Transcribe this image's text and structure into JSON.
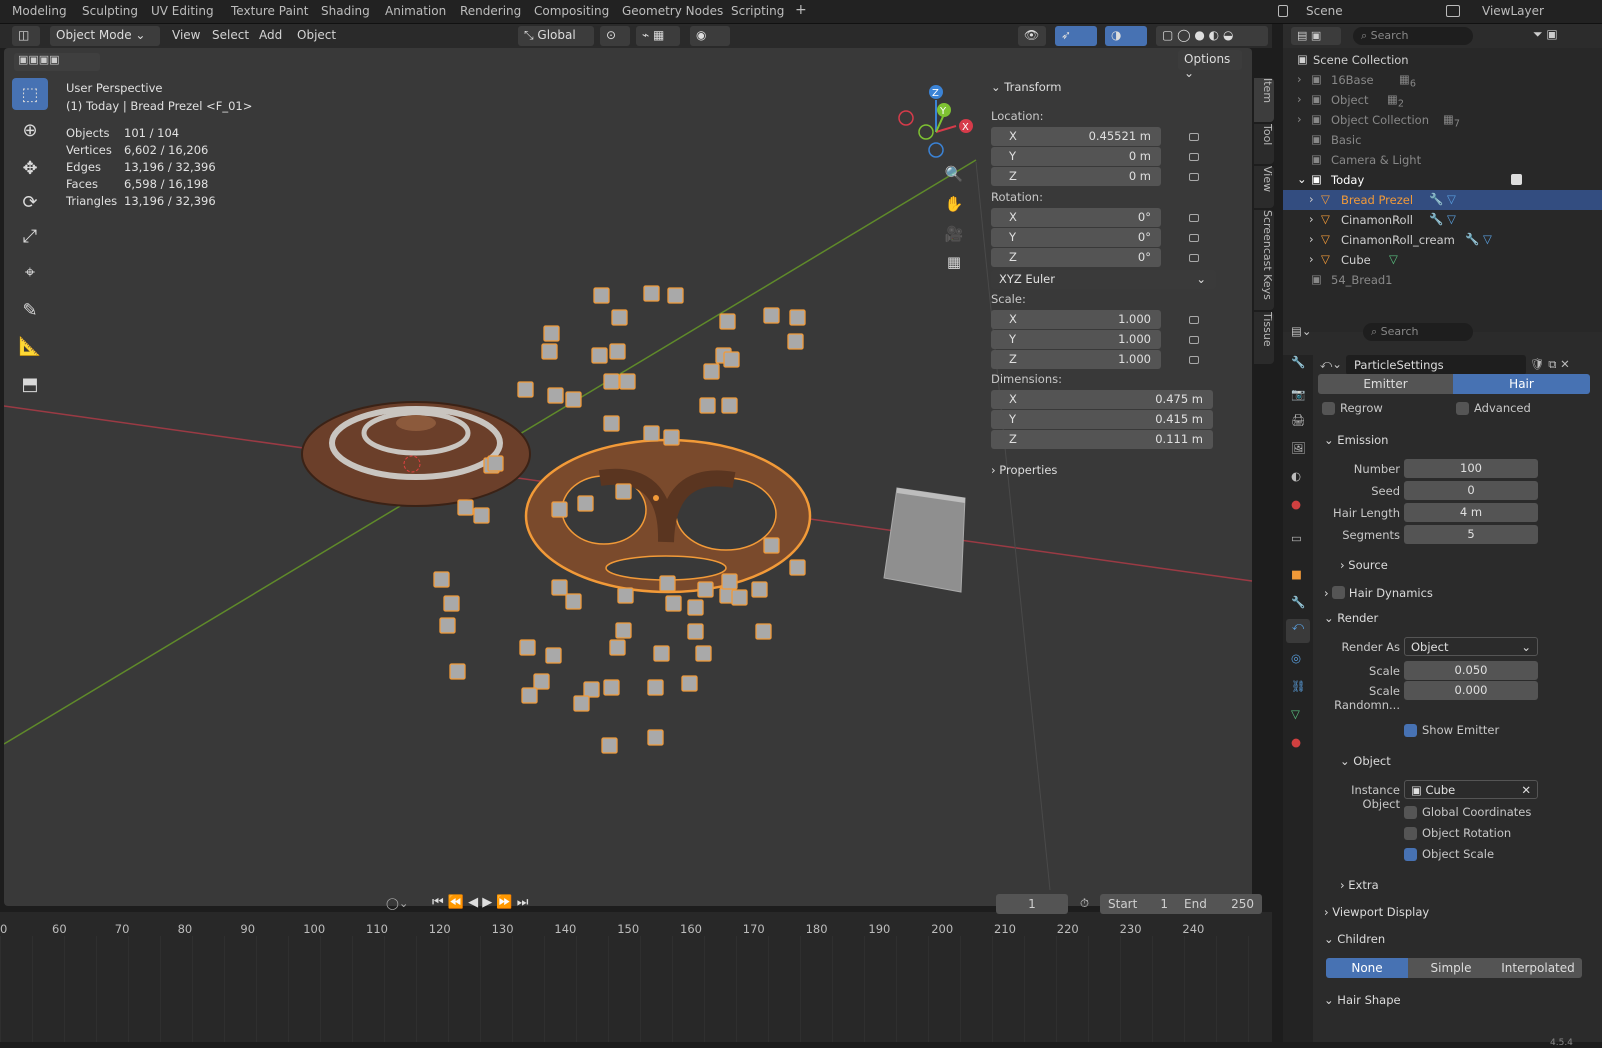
{
  "workspace_tabs": [
    "Modeling",
    "Sculpting",
    "UV Editing",
    "Texture Paint",
    "Shading",
    "Animation",
    "Rendering",
    "Compositing",
    "Geometry Nodes",
    "Scripting",
    "+"
  ],
  "scene_name": "Scene",
  "viewlayer_name": "ViewLayer",
  "header": {
    "mode": "Object Mode",
    "menus": [
      "View",
      "Select",
      "Add",
      "Object"
    ],
    "orientation": "Global",
    "options": "Options"
  },
  "viewport": {
    "perspective": "User Perspective",
    "context": "(1) Today | Bread Prezel <F_01>",
    "stats": [
      {
        "label": "Objects",
        "value": "101 / 104"
      },
      {
        "label": "Vertices",
        "value": "6,602 / 16,206"
      },
      {
        "label": "Edges",
        "value": "13,196 / 32,396"
      },
      {
        "label": "Faces",
        "value": "6,598 / 16,198"
      },
      {
        "label": "Triangles",
        "value": "13,196 / 32,396"
      }
    ]
  },
  "npanel": {
    "title": "Transform",
    "location_label": "Location:",
    "location": [
      {
        "axis": "X",
        "value": "0.45521 m"
      },
      {
        "axis": "Y",
        "value": "0 m"
      },
      {
        "axis": "Z",
        "value": "0 m"
      }
    ],
    "rotation_label": "Rotation:",
    "rotation": [
      {
        "axis": "X",
        "value": "0°"
      },
      {
        "axis": "Y",
        "value": "0°"
      },
      {
        "axis": "Z",
        "value": "0°"
      }
    ],
    "rotation_mode": "XYZ Euler",
    "scale_label": "Scale:",
    "scale": [
      {
        "axis": "X",
        "value": "1.000"
      },
      {
        "axis": "Y",
        "value": "1.000"
      },
      {
        "axis": "Z",
        "value": "1.000"
      }
    ],
    "dimensions_label": "Dimensions:",
    "dimensions": [
      {
        "axis": "X",
        "value": "0.475 m"
      },
      {
        "axis": "Y",
        "value": "0.415 m"
      },
      {
        "axis": "Z",
        "value": "0.111 m"
      }
    ],
    "properties": "Properties",
    "side_tabs": [
      "Item",
      "Tool",
      "View",
      "Screencast Keys",
      "Tissue"
    ]
  },
  "outliner": {
    "search_placeholder": "Search",
    "root": "Scene Collection",
    "rows": [
      "16Base",
      "Object",
      "Object Collection",
      "Basic",
      "Camera & Light",
      "Today",
      "Bread Prezel",
      "CinamonRoll",
      "CinamonRoll_cream",
      "Cube",
      "54_Bread1"
    ],
    "badges": [
      "6",
      "2",
      "7"
    ]
  },
  "properties": {
    "search_placeholder": "Search",
    "particle_settings": "ParticleSettings",
    "type_tabs": [
      "Emitter",
      "Hair"
    ],
    "regrow": "Regrow",
    "advanced": "Advanced",
    "emission": "Emission",
    "emission_fields": [
      {
        "label": "Number",
        "value": "100"
      },
      {
        "label": "Seed",
        "value": "0"
      },
      {
        "label": "Hair Length",
        "value": "4 m"
      },
      {
        "label": "Segments",
        "value": "5"
      }
    ],
    "source": "Source",
    "hair_dynamics": "Hair Dynamics",
    "render": "Render",
    "render_as_label": "Render As",
    "render_as": "Object",
    "scale_label": "Scale",
    "scale": "0.050",
    "scale_random_label": "Scale Randomn...",
    "scale_random": "0.000",
    "show_emitter": "Show Emitter",
    "object": "Object",
    "instance_object_label": "Instance Object",
    "instance_object": "Cube",
    "global_coordinates": "Global Coordinates",
    "object_rotation": "Object Rotation",
    "object_scale": "Object Scale",
    "extra": "Extra",
    "viewport_display": "Viewport Display",
    "children": "Children",
    "children_tabs": [
      "None",
      "Simple",
      "Interpolated"
    ],
    "hair_shape": "Hair Shape"
  },
  "timeline": {
    "current_frame": "1",
    "start_label": "Start",
    "start": "1",
    "end_label": "End",
    "end": "250",
    "ticks": [
      "0",
      "60",
      "70",
      "80",
      "90",
      "100",
      "110",
      "120",
      "130",
      "140",
      "150",
      "160",
      "170",
      "180",
      "190",
      "200",
      "210",
      "220",
      "230",
      "240"
    ]
  },
  "version": "4.5.4",
  "colors": {
    "accent": "#4772b3",
    "selected": "#f29a38",
    "x_axis": "#d63b4a",
    "y_axis": "#7ec232",
    "z_axis": "#3b83d6"
  }
}
